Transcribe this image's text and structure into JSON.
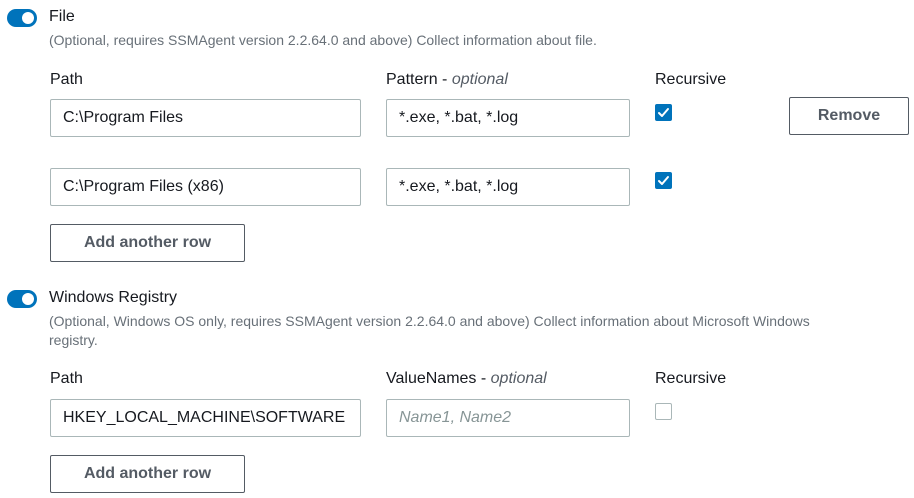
{
  "file_section": {
    "title": "File",
    "description": "(Optional, requires SSMAgent version 2.2.64.0 and above) Collect information about file.",
    "columns": {
      "path": "Path",
      "pattern": "Pattern",
      "pattern_suffix": "- ",
      "pattern_optional": "optional",
      "recursive": "Recursive"
    },
    "rows": [
      {
        "path": "C:\\Program Files",
        "pattern": "*.exe, *.bat, *.log",
        "recursive": true
      },
      {
        "path": "C:\\Program Files (x86)",
        "pattern": "*.exe, *.bat, *.log",
        "recursive": true
      }
    ],
    "remove_label": "Remove",
    "add_row_label": "Add another row"
  },
  "registry_section": {
    "title": "Windows Registry",
    "description": "(Optional, Windows OS only, requires SSMAgent version 2.2.64.0 and above) Collect information about Microsoft Windows registry.",
    "columns": {
      "path": "Path",
      "valuenames": "ValueNames",
      "valuenames_suffix": "- ",
      "valuenames_optional": "optional",
      "recursive": "Recursive"
    },
    "rows": [
      {
        "path": "HKEY_LOCAL_MACHINE\\SOFTWARE",
        "valuenames_placeholder": "Name1, Name2",
        "recursive": false
      }
    ],
    "add_row_label": "Add another row"
  },
  "colors": {
    "accent": "#0073bb",
    "border": "#aab7b8",
    "muted_text": "#687078"
  }
}
